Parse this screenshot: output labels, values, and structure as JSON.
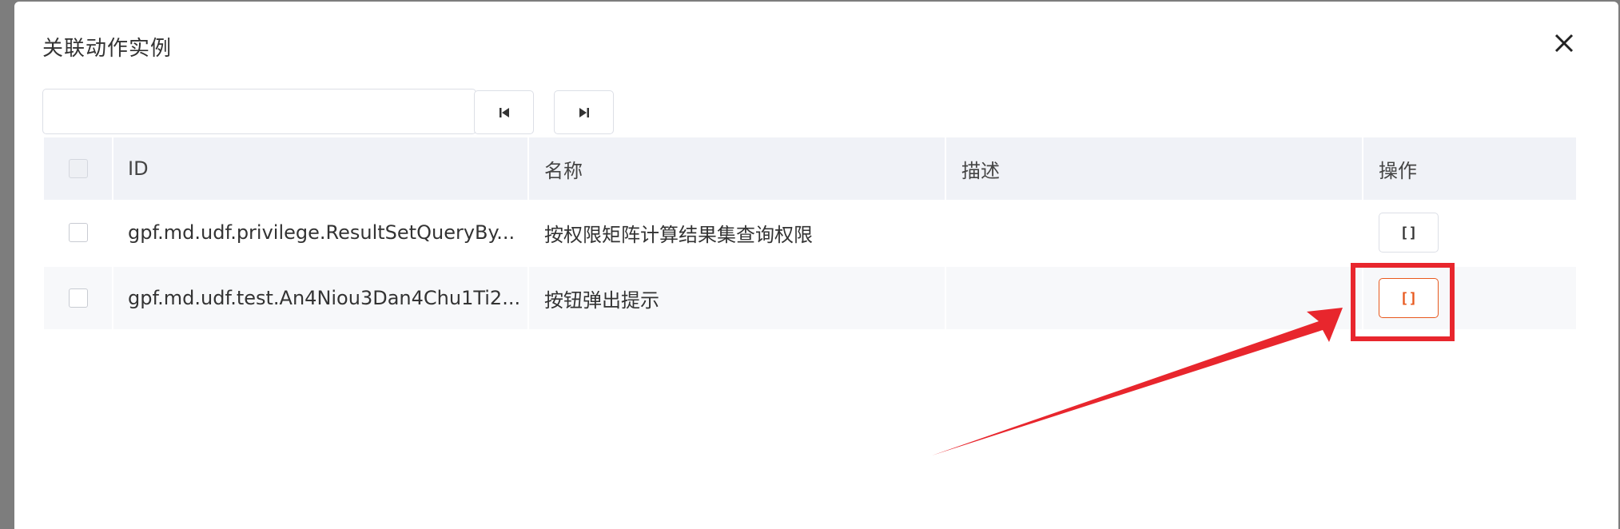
{
  "dialog": {
    "title": "关联动作实例"
  },
  "search": {
    "value": "",
    "placeholder": ""
  },
  "pager": {
    "first_icon": "skip-to-first-icon",
    "last_icon": "skip-to-last-icon"
  },
  "table": {
    "columns": {
      "id": "ID",
      "name": "名称",
      "description": "描述",
      "operation": "操作"
    },
    "rows": [
      {
        "id": "gpf.md.udf.privilege.ResultSetQueryBy...",
        "name": "按权限矩阵计算结果集查询权限",
        "description": "",
        "action_label": "[]"
      },
      {
        "id": "gpf.md.udf.test.An4Niou3Dan4Chu1Ti2...",
        "name": "按钮弹出提示",
        "description": "",
        "action_label": "[]"
      }
    ]
  },
  "annotation": {
    "highlight_color": "#e8262d"
  },
  "colors": {
    "accent": "#e8591e",
    "overlay": "#7d7d7d",
    "header_bg": "#f0f2f7"
  }
}
